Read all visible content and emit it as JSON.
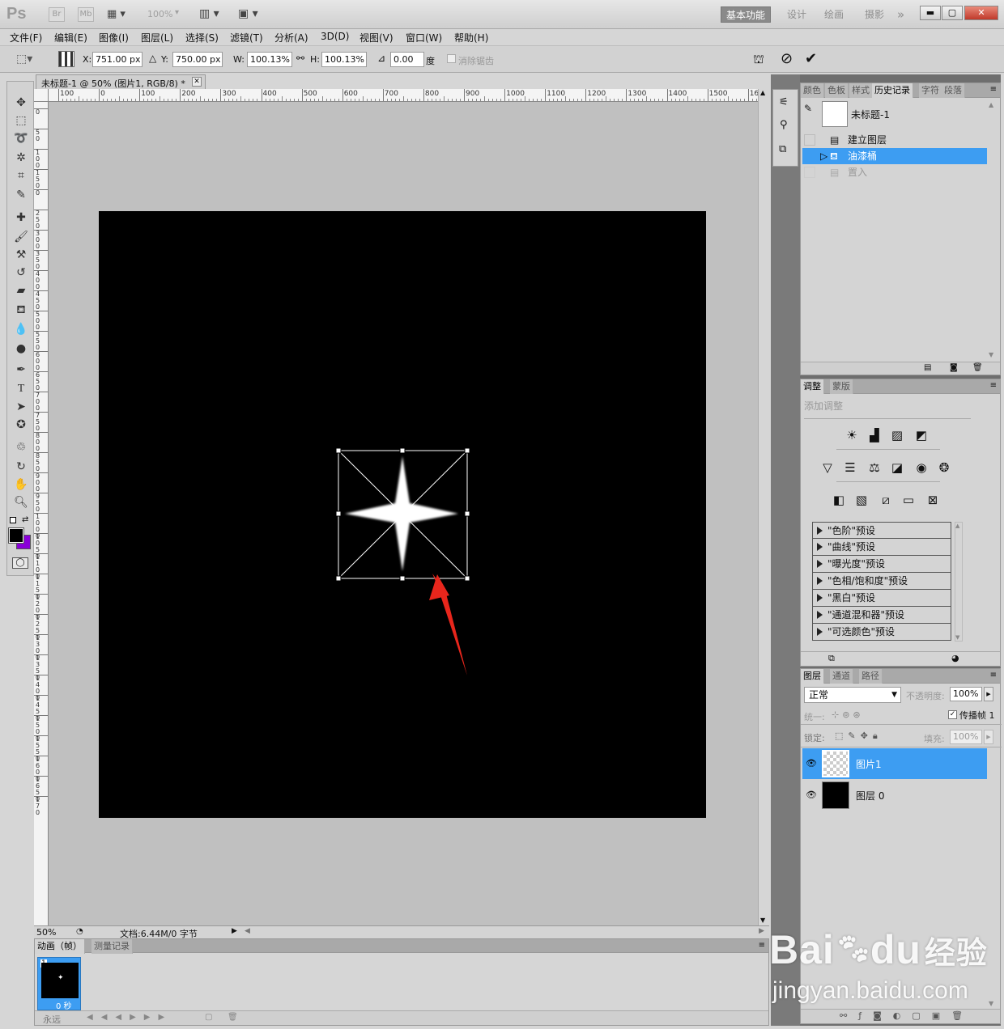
{
  "app": {
    "logo": "Ps",
    "titlebar_buttons": [
      "Br",
      "Mb"
    ],
    "zoom_dropdown": "100%",
    "workspaces": [
      "基本功能",
      "设计",
      "绘画",
      "摄影"
    ],
    "workspace_more": "»"
  },
  "menu": [
    "文件(F)",
    "编辑(E)",
    "图像(I)",
    "图层(L)",
    "选择(S)",
    "滤镜(T)",
    "分析(A)",
    "3D(D)",
    "视图(V)",
    "窗口(W)",
    "帮助(H)"
  ],
  "options": {
    "x_label": "X:",
    "x_value": "751.00 px",
    "y_label": "Y:",
    "y_value": "750.00 px",
    "w_label": "W:",
    "w_value": "100.13%",
    "h_label": "H:",
    "h_value": "100.13%",
    "angle_value": "0.00",
    "angle_unit": "度",
    "antialias_label": "消除锯齿"
  },
  "document": {
    "tab_title": "未标题-1 @ 50% (图片1, RGB/8) *",
    "ruler_top_labels": [
      "100",
      "0",
      "100",
      "200",
      "300",
      "400",
      "500",
      "600",
      "700",
      "800",
      "900",
      "1000",
      "1100",
      "1200",
      "1300",
      "1400",
      "1500",
      "160"
    ],
    "ruler_left_labels": [
      "0",
      "5\n0",
      "1\n0\n0",
      "1\n5\n0",
      "0",
      "2\n5\n0",
      "3\n0\n0",
      "3\n5\n0",
      "4\n0\n0",
      "4\n5\n0",
      "5\n0\n0",
      "5\n5\n0",
      "6\n0\n0",
      "6\n5\n0",
      "7\n0\n0",
      "7\n5\n0",
      "8\n0\n0",
      "8\n5\n0",
      "9\n0\n0",
      "9\n5\n0",
      "1\n0\n0\n0",
      "1\n0\n5\n0",
      "1\n1\n0\n0",
      "1\n1\n5\n0",
      "1\n2\n0\n0",
      "1\n2\n5\n0",
      "1\n3\n0\n0",
      "1\n3\n5\n0",
      "1\n4\n0\n0",
      "1\n4\n5\n0",
      "1\n5\n0\n0",
      "1\n5\n5\n0",
      "1\n6\n0\n0",
      "1\n6\n5\n0",
      "1\n7\n0"
    ],
    "zoom": "50%",
    "doc_info": "文档:6.44M/0 字节"
  },
  "animation_panel": {
    "tabs": [
      "动画（帧）",
      "测量记录"
    ],
    "frame_number": "1",
    "frame_delay": "0 秒",
    "loop": "永远"
  },
  "history_panel": {
    "tabs": [
      "颜色",
      "色板",
      "样式",
      "历史记录",
      "字符",
      "段落"
    ],
    "snapshot_name": "未标题-1",
    "items": [
      {
        "label": "建立图层",
        "state": "normal"
      },
      {
        "label": "油漆桶",
        "state": "selected"
      },
      {
        "label": "置入",
        "state": "disabled"
      }
    ]
  },
  "adjustments_panel": {
    "tabs": [
      "调整",
      "蒙版"
    ],
    "heading": "添加调整",
    "presets": [
      "\"色阶\"预设",
      "\"曲线\"预设",
      "\"曝光度\"预设",
      "\"色相/饱和度\"预设",
      "\"黑白\"预设",
      "\"通道混和器\"预设",
      "\"可选颜色\"预设"
    ]
  },
  "layers_panel": {
    "tabs": [
      "图层",
      "通道",
      "路径"
    ],
    "blend_mode": "正常",
    "opacity_label": "不透明度:",
    "opacity_value": "100%",
    "unify_label": "统一:",
    "propagate_label": "传播帧 1",
    "lock_label": "锁定:",
    "fill_label": "填充:",
    "fill_value": "100%",
    "layers": [
      {
        "name": "图片1",
        "selected": true
      },
      {
        "name": "图层 0",
        "selected": false
      }
    ]
  },
  "watermark": {
    "brand": "Bai",
    "brand2": "du",
    "brand3": "经验",
    "url": "jingyan.baidu.com"
  },
  "colors": {
    "selection": "#3d9df2",
    "canvas_bg": "#c0c0c0",
    "arrow": "#e8261c",
    "background_swatch": "#8a00d8"
  }
}
